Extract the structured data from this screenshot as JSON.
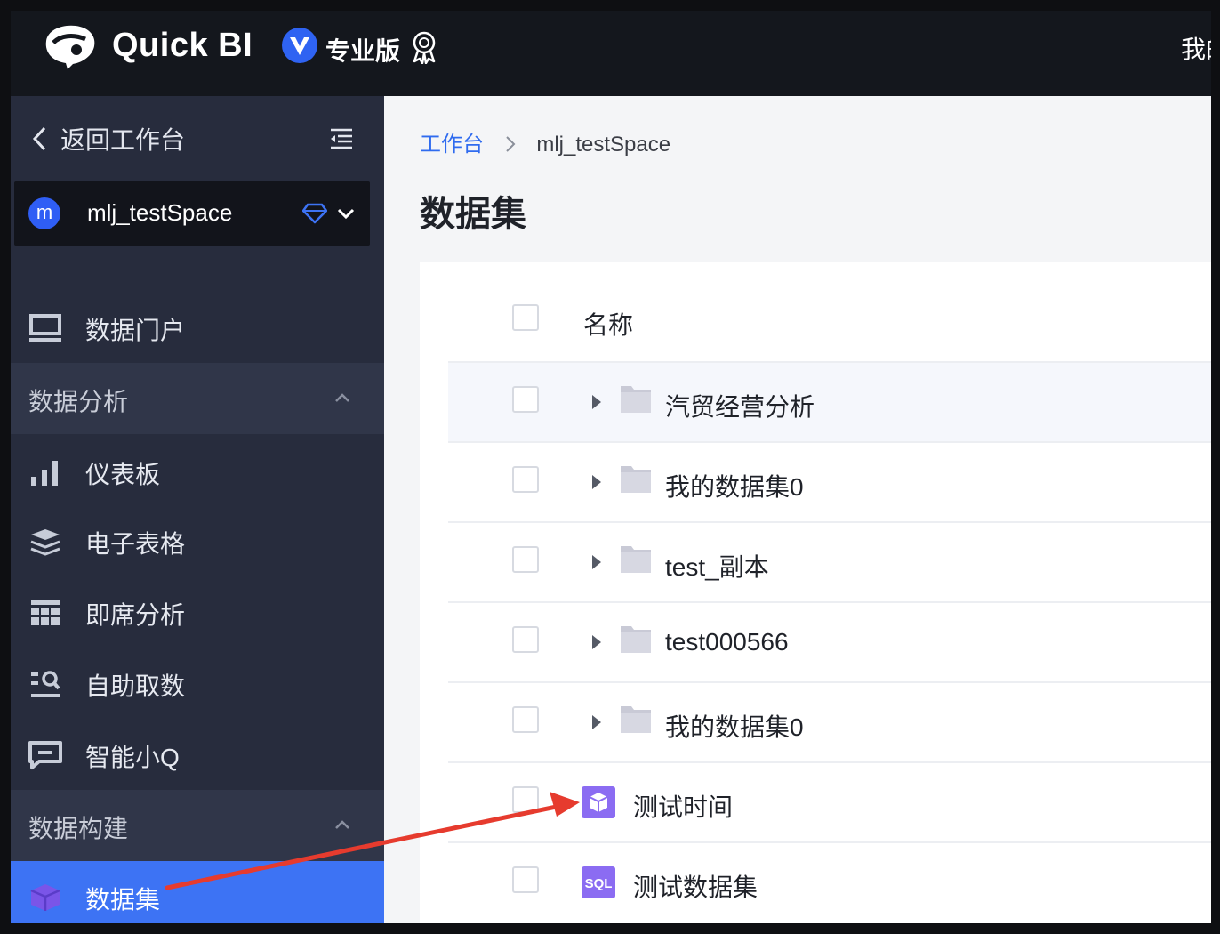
{
  "topbar": {
    "brand": "Quick BI",
    "edition": "专业版",
    "right_text": "我的"
  },
  "sidebar": {
    "back_label": "返回工作台",
    "space": {
      "avatar": "m",
      "name": "mlj_testSpace"
    },
    "portal_label": "数据门户",
    "groups": [
      {
        "label": "数据分析",
        "items": [
          {
            "label": "仪表板",
            "icon": "bar-chart-icon"
          },
          {
            "label": "电子表格",
            "icon": "layers-icon"
          },
          {
            "label": "即席分析",
            "icon": "grid-table-icon"
          },
          {
            "label": "自助取数",
            "icon": "search-data-icon"
          },
          {
            "label": "智能小Q",
            "icon": "chat-bubble-icon"
          }
        ]
      },
      {
        "label": "数据构建",
        "items": [
          {
            "label": "数据集",
            "icon": "cube-icon",
            "active": true
          }
        ]
      }
    ]
  },
  "main": {
    "breadcrumb": {
      "link": "工作台",
      "current": "mlj_testSpace"
    },
    "title": "数据集",
    "table": {
      "column_name": "名称",
      "rows": [
        {
          "type": "folder",
          "label": "汽贸经营分析"
        },
        {
          "type": "folder",
          "label": "我的数据集0"
        },
        {
          "type": "folder",
          "label": "test_副本"
        },
        {
          "type": "folder",
          "label": "test000566"
        },
        {
          "type": "folder",
          "label": "我的数据集0"
        },
        {
          "type": "dataset",
          "label": "测试时间",
          "icon": "cube-icon"
        },
        {
          "type": "dataset",
          "label": "测试数据集",
          "icon": "sql-icon",
          "icon_text": "SQL"
        }
      ]
    }
  },
  "colors": {
    "topbar_bg": "#14171d",
    "sidebar_bg": "#272c3d",
    "active_blue": "#3d73f4",
    "link_blue": "#2f6bef",
    "dataset_purple": "#8b6cf2",
    "annotation_red": "#e63b2e"
  }
}
